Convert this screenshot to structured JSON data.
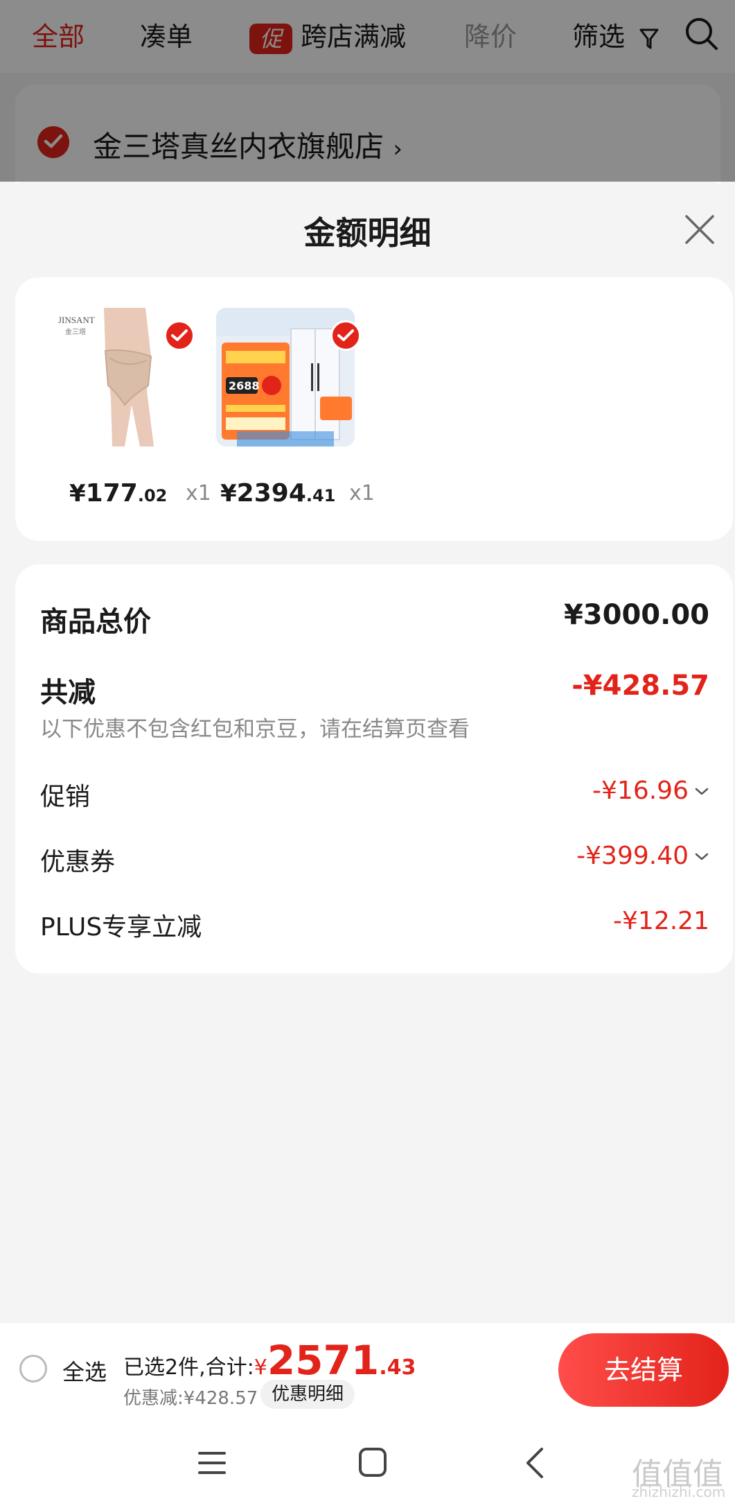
{
  "top_nav": {
    "tab_all": "全部",
    "tab_bundle": "凑单",
    "promo_badge": "促",
    "tab_cross_store": "跨店满减",
    "tab_price_drop": "降价",
    "filter_label": "筛选",
    "icons": [
      "filter-icon",
      "search-icon"
    ]
  },
  "store": {
    "name": "金三塔真丝内衣旗舰店",
    "chevron": "›"
  },
  "sheet": {
    "title": "金额明细",
    "products": [
      {
        "price_yen": "¥",
        "price_int": "177",
        "price_dec": ".02",
        "qty": "x1",
        "brand_text": "JINSANT",
        "brand_sub": "金三塔"
      },
      {
        "price_yen": "¥",
        "price_int": "2394",
        "price_dec": ".41",
        "qty": "x1",
        "promo_price": "2688"
      }
    ],
    "summary": {
      "goods_total_label": "商品总价",
      "goods_total_value": "¥3000.00",
      "total_reduction_label": "共减",
      "total_reduction_value": "-¥428.57",
      "note": "以下优惠不包含红包和京豆，请在结算页查看",
      "promotion_label": "促销",
      "promotion_value": "-¥16.96",
      "coupon_label": "优惠券",
      "coupon_value": "-¥399.40",
      "plus_label": "PLUS专享立减",
      "plus_value": "-¥12.21"
    }
  },
  "bottom_bar": {
    "select_all": "全选",
    "selected_prefix": "已选2件,合计:",
    "total_yen": "¥",
    "total_int": "2571",
    "total_dec": ".43",
    "saved": "优惠减:¥428.57",
    "detail_button": "优惠明细",
    "checkout_button": "去结算"
  },
  "watermark": {
    "text": "值值值",
    "sub": "zhizhizhi.com"
  },
  "colors": {
    "accent": "#e2231a",
    "sheet_bg": "#f4f4f4",
    "card_bg": "#ffffff"
  }
}
